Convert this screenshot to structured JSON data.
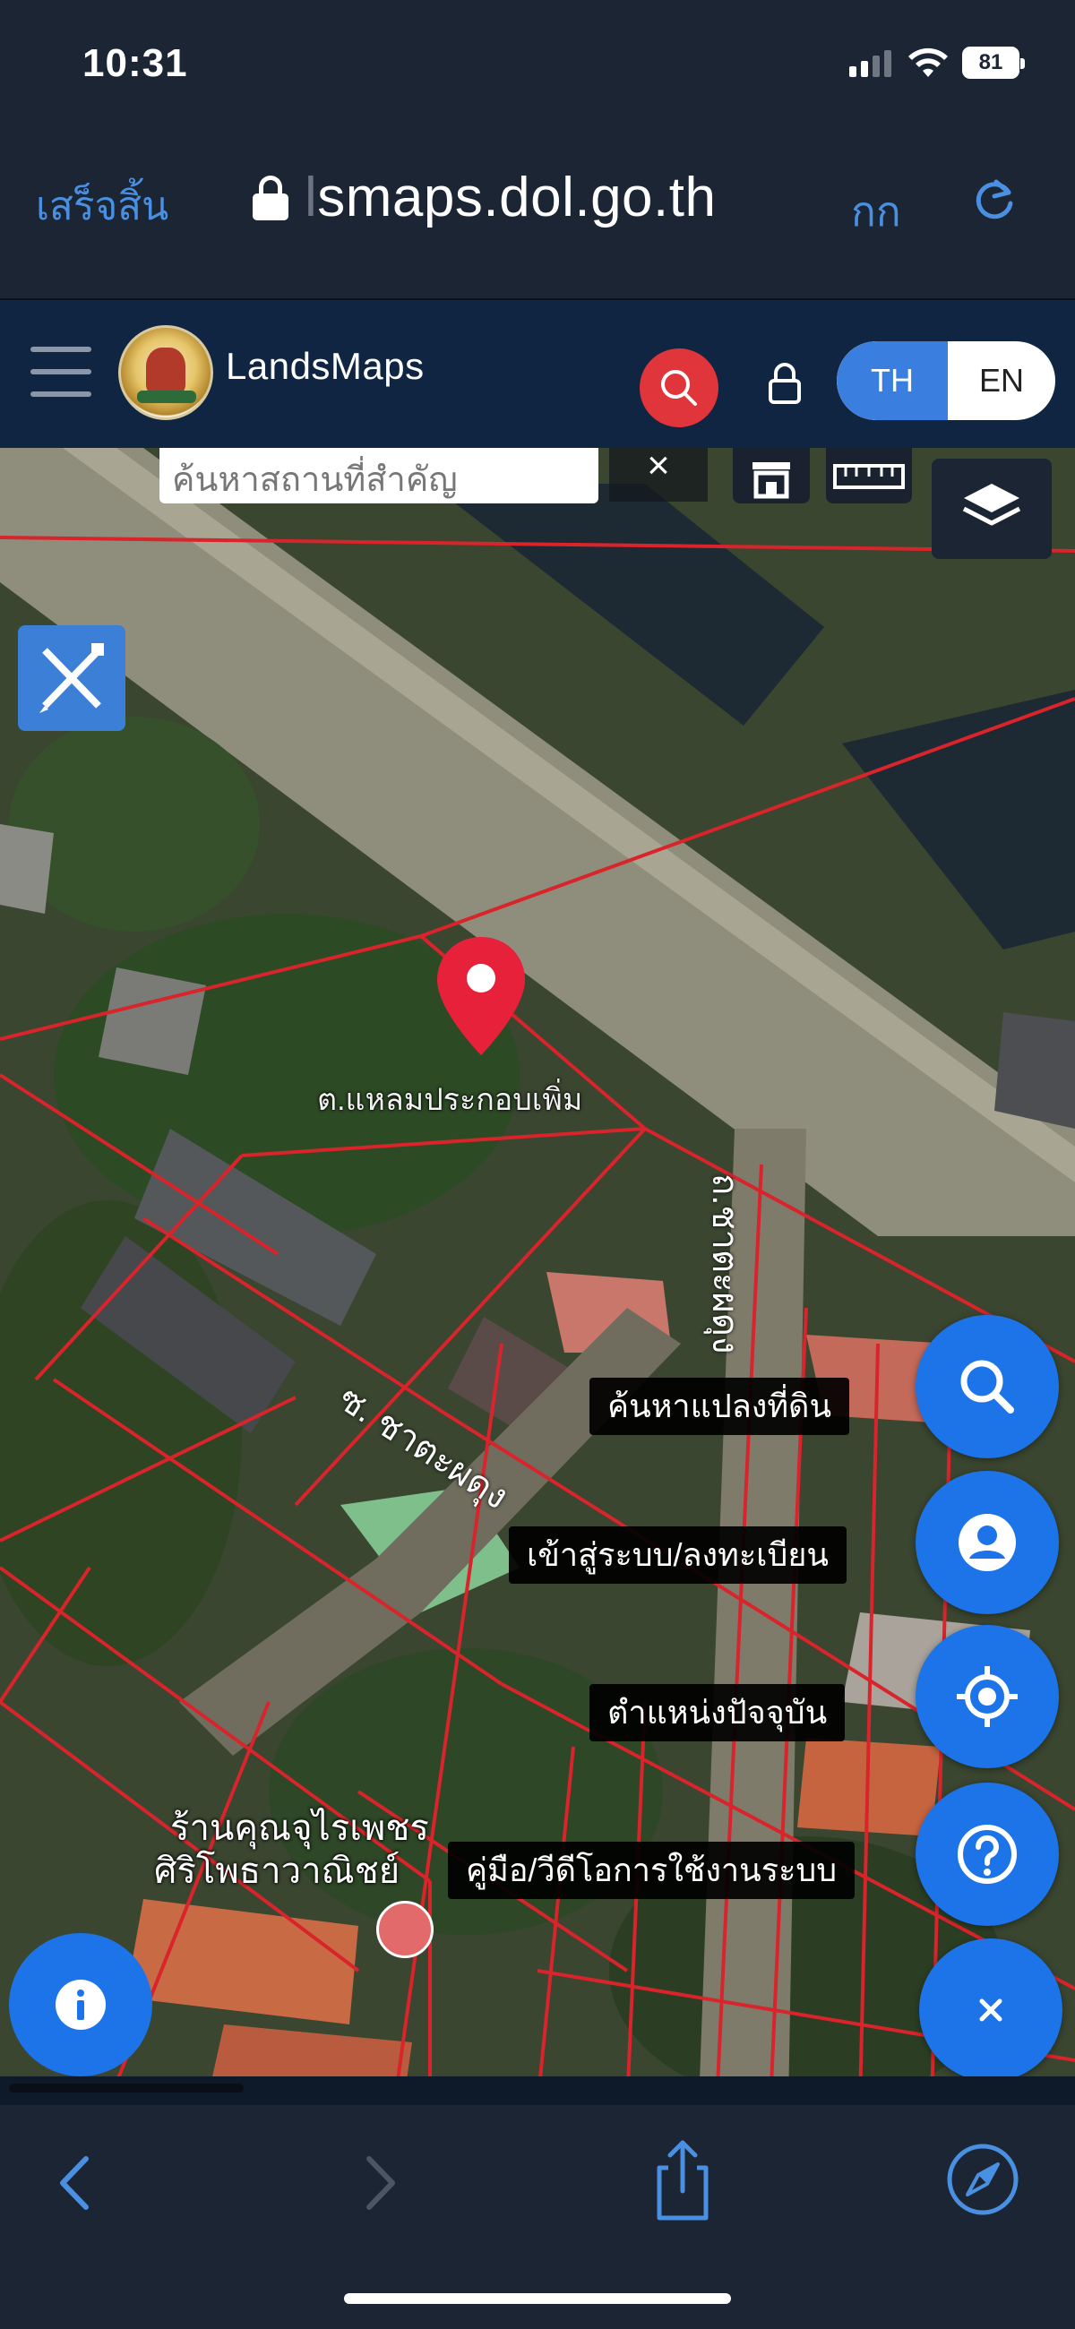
{
  "status_bar": {
    "time": "10:31",
    "battery": "81"
  },
  "browser": {
    "done_label": "เสร็จสิ้น",
    "url_prefix": "l",
    "url": "smaps.dol.go.th",
    "text_size_label": "กก",
    "accent_color": "#4a90e2"
  },
  "app": {
    "title": "LandsMaps",
    "lang_th": "TH",
    "lang_en": "EN",
    "active_lang": "TH",
    "brand_color": "#0f2541",
    "search_color": "#e0353b"
  },
  "map": {
    "search_placeholder": "ค้นหาสถานที่สำคัญ",
    "clear_label": "×",
    "parcel_label": "ต.แหลมประกอบเพิ่ม",
    "street_label_1": "ซ. ชาตะผดุง",
    "street_label_2": "ถ.ชาตะผดุง",
    "poi_label_1": "ร้านคุณจุไรเพชร",
    "poi_label_2": "ศิริโพธาวาณิชย์",
    "boundary_color": "#d8242a",
    "pin_color": "#e8213a"
  },
  "fab_menu": {
    "items": [
      {
        "label": "ค้นหาแปลงที่ดิน",
        "icon": "search-icon"
      },
      {
        "label": "เข้าสู่ระบบ/ลงทะเบียน",
        "icon": "user-icon"
      },
      {
        "label": "ตำแหน่งปัจจุบัน",
        "icon": "locate-icon"
      },
      {
        "label": "คู่มือ/วีดีโอการใช้งานระบบ",
        "icon": "help-icon"
      }
    ],
    "close_icon": "close-icon",
    "fab_color": "#1d74e8"
  },
  "info_button": {
    "icon": "info-icon"
  },
  "toolbar": {
    "icons": [
      "back-icon",
      "forward-icon",
      "share-icon",
      "compass-icon"
    ]
  }
}
